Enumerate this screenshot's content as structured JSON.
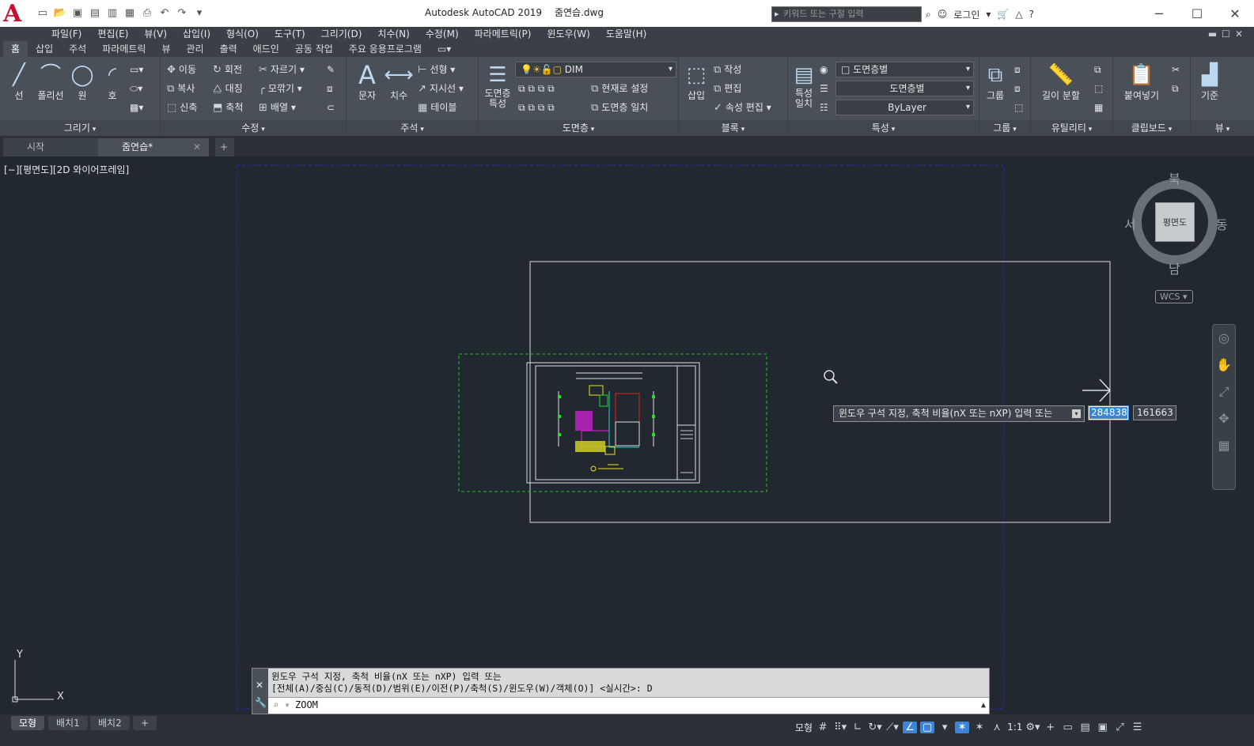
{
  "app": {
    "title": "Autodesk AutoCAD 2019",
    "file": "줌연습.dwg"
  },
  "search": {
    "placeholder": "키워드 또는 구절 입력"
  },
  "login": "로그인",
  "menu": [
    "파일(F)",
    "편집(E)",
    "뷰(V)",
    "삽입(I)",
    "형식(O)",
    "도구(T)",
    "그리기(D)",
    "치수(N)",
    "수정(M)",
    "파라메트릭(P)",
    "윈도우(W)",
    "도움말(H)"
  ],
  "ribbon_tabs": [
    "홈",
    "삽입",
    "주석",
    "파라메트릭",
    "뷰",
    "관리",
    "출력",
    "애드인",
    "공동 작업",
    "주요 응용프로그램"
  ],
  "draw": {
    "line": "선",
    "polyline": "폴리선",
    "circle": "원",
    "arc": "호",
    "footer": "그리기"
  },
  "modify": {
    "move": "이동",
    "rotate": "회전",
    "trim": "자르기",
    "copy": "복사",
    "mirror": "대칭",
    "fillet": "모깎기",
    "stretch": "신축",
    "scale": "축척",
    "array": "배열",
    "footer": "수정"
  },
  "annotation": {
    "text": "문자",
    "dimension": "치수",
    "linear": "선형",
    "leader": "지시선",
    "table": "테이블",
    "footer": "주석"
  },
  "layers": {
    "properties": "도면층\n특성",
    "current_layer": "DIM",
    "set_current": "현재로 설정",
    "match_layer": "도면층 일치",
    "footer": "도면층"
  },
  "block": {
    "insert": "삽입",
    "create": "작성",
    "edit": "편집",
    "attr_edit": "속성 편집",
    "footer": "블록"
  },
  "properties": {
    "match": "특성\n일치",
    "color": "도면층별",
    "linetype": "도면층별",
    "lineweight": "ByLayer",
    "footer": "특성"
  },
  "groups": {
    "group": "그룹",
    "footer": "그룹"
  },
  "utilities": {
    "measure": "길이 분할",
    "footer": "유틸리티"
  },
  "clipboard": {
    "paste": "붙여넣기",
    "footer": "클립보드"
  },
  "view_panel": {
    "base": "기준",
    "footer": "뷰"
  },
  "doc_tabs": {
    "start": "시작",
    "current": "줌연습*"
  },
  "viewport": {
    "label": "[−][평면도][2D 와이어프레임]"
  },
  "viewcube": {
    "north": "북",
    "south": "남",
    "east": "동",
    "west": "서",
    "face": "평면도",
    "wcs": "WCS"
  },
  "dynamic": {
    "prompt": "윈도우 구석 지정, 축척 비율(nX 또는 nXP) 입력 또는",
    "x": "284838",
    "y": "161663"
  },
  "command": {
    "line1": "윈도우 구석 지정, 축척 비율(nX 또는 nXP) 입력 또는",
    "line2": "[전체(A)/중심(C)/동적(D)/범위(E)/이전(P)/축척(S)/윈도우(W)/객체(O)] <실시간>: D",
    "input": "ZOOM"
  },
  "layout_tabs": [
    "모형",
    "배치1",
    "배치2"
  ],
  "status": {
    "model": "모형",
    "scale": "1:1"
  },
  "colors": {
    "canvas": "#212830",
    "ribbon": "#4a5058",
    "accent": "#3b84d8",
    "view_box": "#2a2ab0",
    "dyn_box": "#22c022"
  }
}
